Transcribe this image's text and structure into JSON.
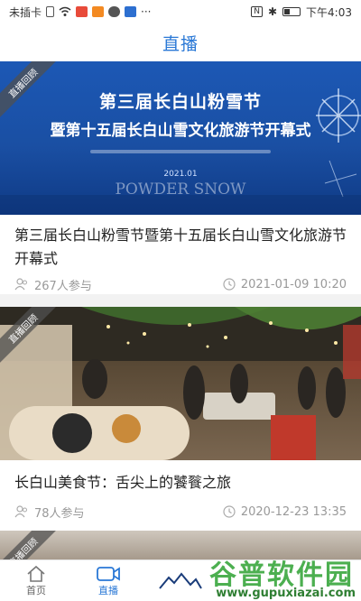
{
  "status": {
    "carrier": "未插卡",
    "time": "下午4:03",
    "more": "···"
  },
  "header": {
    "title": "直播"
  },
  "cards": [
    {
      "ribbon": "直播回顾",
      "banner_title_1": "第三届长白山粉雪节",
      "banner_title_2": "暨第十五届长白山雪文化旅游节开幕式",
      "banner_year": "2021.01",
      "banner_powder": "POWDER SNOW",
      "title": "第三届长白山粉雪节暨第十五届长白山雪文化旅游节开幕式",
      "participants": "267人参与",
      "datetime": "2021-01-09 10:20"
    },
    {
      "ribbon": "直播回顾",
      "title": "长白山美食节：舌尖上的饕餮之旅",
      "participants": "78人参与",
      "datetime": "2020-12-23 13:35"
    },
    {
      "ribbon": "直播回顾"
    }
  ],
  "tabs": [
    {
      "label": "首页",
      "icon": "home-icon"
    },
    {
      "label": "直播",
      "icon": "video-camera-icon"
    }
  ],
  "watermark": {
    "text": "谷普软件园",
    "url": "www.gupuxiazai.com"
  },
  "colors": {
    "accent": "#2a78d6",
    "banner": "#1a4fa3"
  }
}
